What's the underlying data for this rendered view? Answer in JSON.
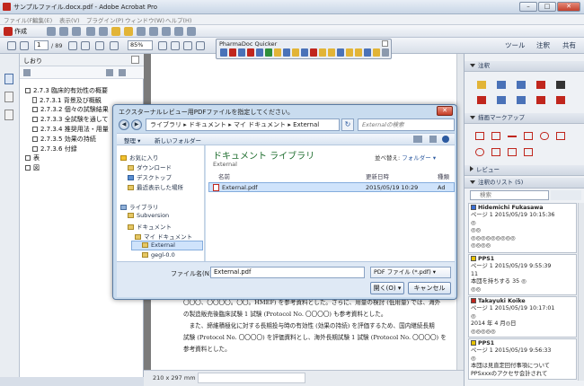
{
  "window": {
    "title": "サンプルファイル.docx.pdf - Adobe Acrobat Pro",
    "minimize": "–",
    "maximize": "□",
    "close": "✕"
  },
  "menu": [
    "ファイル(F)",
    "編集(E)",
    "表示(V)",
    "プラグイン(P)",
    "ウィンドウ(W)",
    "ヘルプ(H)"
  ],
  "toolbar": {
    "create_label": "作成",
    "page_current": "1",
    "page_total": "/ 89",
    "zoom": "85%",
    "tools": "ツール",
    "comment": "注釈",
    "share": "共有"
  },
  "floating_toolbar": {
    "title": "PharmaDoc Quicker"
  },
  "bookmarks": {
    "title": "しおり",
    "items": [
      {
        "label": "2.7.3  臨床的有効性の概要",
        "expanded": true
      },
      {
        "label": "2.7.3.1  背景及び概観"
      },
      {
        "label": "2.7.3.2  個々の試験結果"
      },
      {
        "label": "2.7.3.3  全試験を通して"
      },
      {
        "label": "2.7.3.4  推奨用法・用量"
      },
      {
        "label": "2.7.3.5  効果の持続"
      },
      {
        "label": "2.7.3.6  付録"
      },
      {
        "label": "表"
      },
      {
        "label": "図"
      }
    ]
  },
  "document": {
    "lines": [
      "〇〇〇、〇〇〇〇。〇〇。HMEF) を参考資料とした。さらに、用量の検討 (低用量) では、海外",
      "の製造販売後臨床試験 1 試験 (Protocol No. 〇〇〇〇) も参考資料とした。",
      "　また、締維積極化に対する長期投与時の有効性 (効果の持続) を評価するため、国内継続長期",
      "試験 (Protocol No. 〇〇〇〇) を評価資料とし、海外長期試験 1 試験 (Protocol No. 〇〇〇〇) を",
      "参考資料とした。"
    ],
    "page_size": "210 x 297 mm"
  },
  "dialog": {
    "title": "エクスターナルレビュー用PDFファイルを指定してください。",
    "path": [
      "ライブラリ",
      "ドキュメント",
      "マイ ドキュメント",
      "External"
    ],
    "search_placeholder": "Externalの検索",
    "organize": "整理 ▾",
    "new_folder": "新しいフォルダー",
    "nav": [
      {
        "label": "お気に入り",
        "kind": "star"
      },
      {
        "label": "ダウンロード",
        "kind": "folder"
      },
      {
        "label": "デスクトップ",
        "kind": "folder"
      },
      {
        "label": "最近表示した場所",
        "kind": "folder"
      },
      {
        "label": "ライブラリ",
        "kind": "lib"
      },
      {
        "label": "Subversion",
        "kind": "folder"
      },
      {
        "label": "ドキュメント",
        "kind": "folder"
      },
      {
        "label": "マイ ドキュメント",
        "kind": "folder"
      },
      {
        "label": "External",
        "kind": "folder",
        "selected": true
      },
      {
        "label": "gegl-0.0",
        "kind": "folder"
      }
    ],
    "library_title": "ドキュメント ライブラリ",
    "library_sub": "External",
    "arrange_label": "並べ替え:",
    "arrange_value": "フォルダー ▾",
    "columns": {
      "name": "名前",
      "date": "更新日時",
      "type": "種類"
    },
    "files": [
      {
        "name": "External.pdf",
        "date": "2015/05/19 10:29",
        "type": "Ad"
      }
    ],
    "filename_label": "ファイル名(N):",
    "filename_value": "External.pdf",
    "filetype": "PDF ファイル (*.pdf)",
    "open_label": "開く(O)",
    "cancel_label": "キャンセル"
  },
  "right_pane": {
    "annotations_title": "注釈",
    "drawing_title": "描画マークアップ",
    "review_title": "レビュー",
    "list_title": "注釈のリスト (5)",
    "search_placeholder": "検索",
    "comments": [
      {
        "author": "Hidemichi Fukasawa",
        "lines": [
          "ページ 1  2015/05/19 10:15:36",
          "◎",
          "◎◎",
          "◎◎◎◎◎◎◎◎◎",
          "◎◎◎◎"
        ],
        "color": "#3b6fd4"
      },
      {
        "author": "PPS1",
        "lines": [
          "ページ 1  2015/05/19 9:55:39",
          "11",
          "本団を持ちする 35 ◎",
          "◎◎"
        ],
        "color": "#e6c200"
      },
      {
        "author": "Takayuki Koike",
        "lines": [
          "ページ 1  2015/05/19 10:17:01",
          "◎",
          "2014 年 4 月◎日",
          "◎◎◎◎◎"
        ],
        "color": "#c0261d"
      },
      {
        "author": "PPS1",
        "lines": [
          "ページ 1  2015/05/19 9:56:33",
          "◎",
          "本団は見直定回付事項について",
          "PPSxxxのアクセサ会計されて"
        ],
        "color": "#e6c200"
      }
    ]
  }
}
